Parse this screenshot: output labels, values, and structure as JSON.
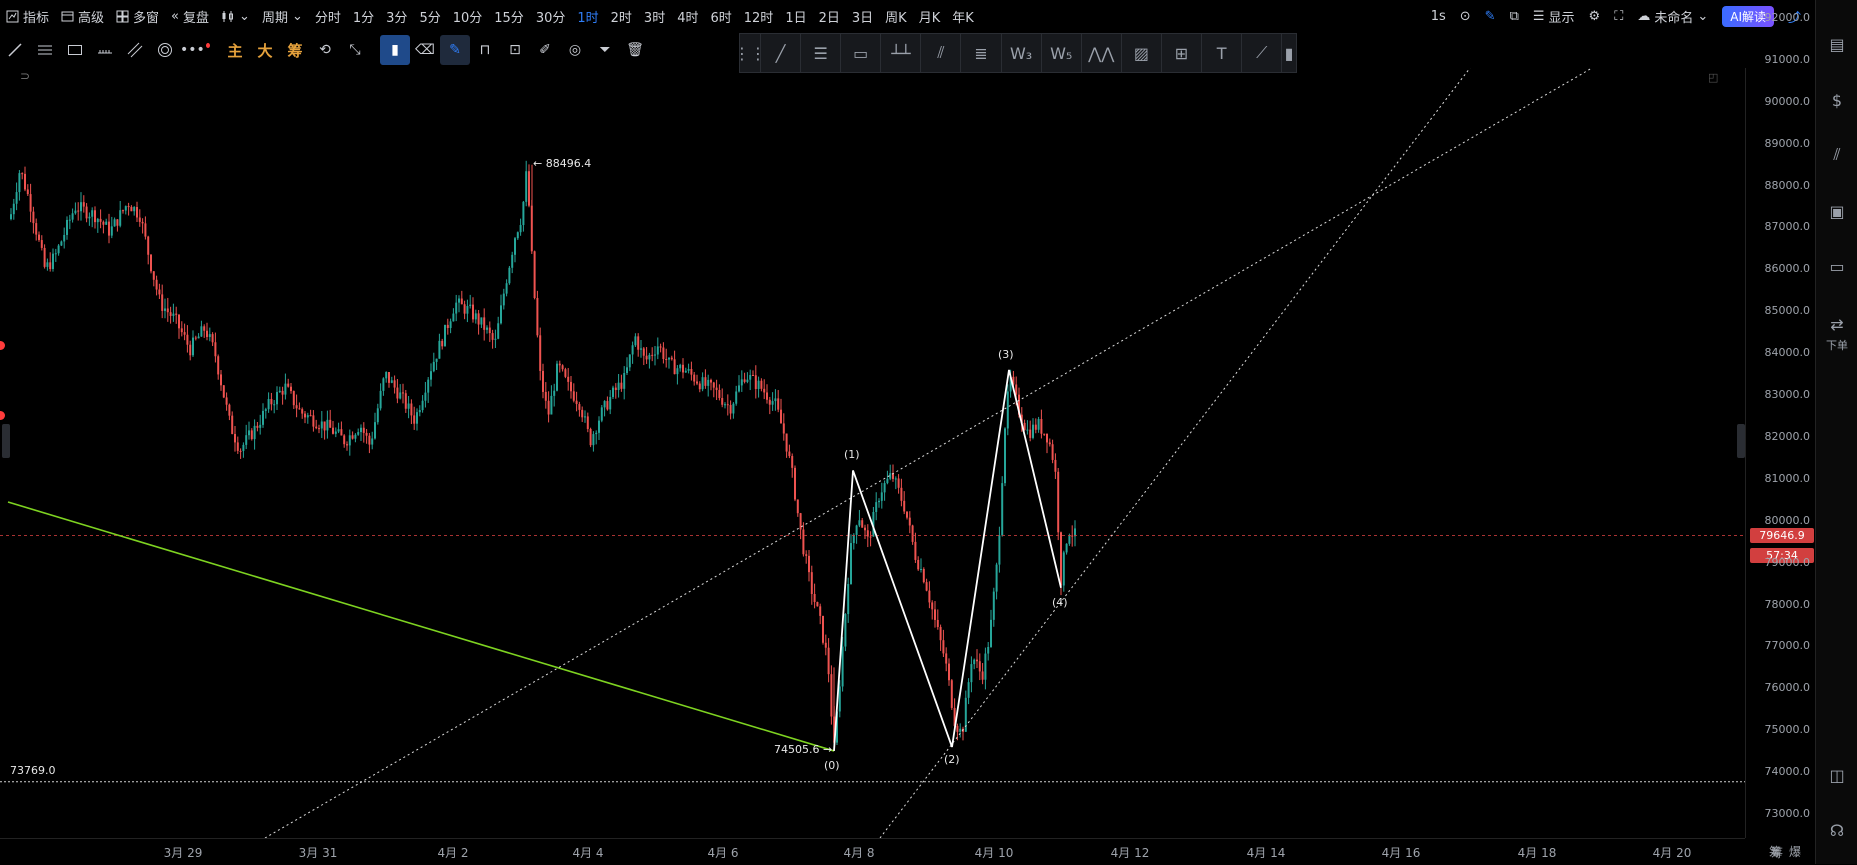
{
  "topbar": {
    "indicator": "指标",
    "advanced": "高级",
    "multi_window": "多窗",
    "replay": "复盘",
    "period": "周期",
    "intervals": [
      "分时",
      "1分",
      "3分",
      "5分",
      "10分",
      "15分",
      "30分",
      "1时",
      "2时",
      "3时",
      "4时",
      "6时",
      "12时",
      "1日",
      "2日",
      "3日",
      "周K",
      "月K",
      "年K"
    ],
    "active_interval": "1时",
    "seconds": "1s",
    "display": "显示",
    "unnamed": "未命名",
    "ai": "AI解读"
  },
  "toolbar2": {
    "main": "主",
    "big": "大",
    "chips": "筹"
  },
  "chart": {
    "high_label": "88496.4",
    "low_label": "74505.6",
    "hline_label": "73769.0",
    "wave_labels": [
      "(0)",
      "(1)",
      "(2)",
      "(3)",
      "(4)"
    ],
    "current_price": "79646.9",
    "countdown": "57:34",
    "price_ticks": [
      "92000.0",
      "91000.0",
      "90000.0",
      "89000.0",
      "88000.0",
      "87000.0",
      "86000.0",
      "85000.0",
      "84000.0",
      "83000.0",
      "82000.0",
      "81000.0",
      "80000.0",
      "79000.0",
      "78000.0",
      "77000.0",
      "76000.0",
      "75000.0",
      "74000.0",
      "73000.0"
    ],
    "time_ticks": [
      "3月 29",
      "3月 31",
      "4月 2",
      "4月 4",
      "4月 6",
      "4月 8",
      "4月 10",
      "4月 12",
      "4月 14",
      "4月 16",
      "4月 18",
      "4月 20"
    ],
    "axis_controls": [
      "筹",
      "爆"
    ]
  },
  "rightbar": {
    "order_label": "下单"
  },
  "colors": {
    "up": "#26a69a",
    "down": "#ef5350",
    "accent": "#2f7df6",
    "trendline": "#7ed321",
    "price_tag": "#d23f3f"
  },
  "icons": [
    "indicator-icon",
    "advanced-icon",
    "multi-window-icon",
    "replay-icon",
    "candle-type-icon",
    "camera-icon",
    "pen-icon",
    "edit-icon",
    "settings-icon",
    "fullscreen-icon",
    "cloud-icon",
    "share-icon"
  ]
}
